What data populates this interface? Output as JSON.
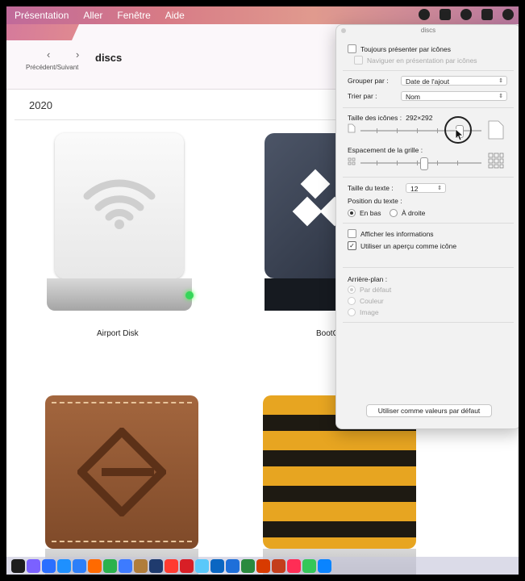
{
  "menubar": {
    "items": [
      "Présentation",
      "Aller",
      "Fenêtre",
      "Aide"
    ]
  },
  "window": {
    "nav_arrows": "‹ ›",
    "nav_label": "Précédent/Suivant",
    "title": "discs",
    "group_header": "2020",
    "items": [
      {
        "label": "Airport Disk"
      },
      {
        "label": "BootC"
      }
    ]
  },
  "panel": {
    "title": "discs",
    "always_icons": "Toujours présenter par icônes",
    "browse_icons": "Naviguer en présentation par icônes",
    "group_by_label": "Grouper par :",
    "group_by_value": "Date de l'ajout",
    "sort_by_label": "Trier par :",
    "sort_by_value": "Nom",
    "icon_size_label": "Taille des icônes :",
    "icon_size_value": "292×292",
    "grid_spacing_label": "Espacement de la grille :",
    "text_size_label": "Taille du texte :",
    "text_size_value": "12",
    "text_position_label": "Position du texte :",
    "pos_bottom": "En bas",
    "pos_right": "À droite",
    "show_info": "Afficher les informations",
    "use_preview": "Utiliser un aperçu comme icône",
    "background_label": "Arrière-plan :",
    "bg_default": "Par défaut",
    "bg_color": "Couleur",
    "bg_image": "Image",
    "use_defaults": "Utiliser comme valeurs par défaut"
  },
  "dock": {
    "colors": [
      "#1d1d1d",
      "#7b61ff",
      "#2b6fff",
      "#1e90ff",
      "#2d7ff9",
      "#ff6a00",
      "#2bb24c",
      "#3d7bff",
      "#b07d3b",
      "#1f3b6e",
      "#ff3b30",
      "#d81f26",
      "#5ac8fa",
      "#0a66c2",
      "#1e6fd9",
      "#2a8a3e",
      "#d83b01",
      "#c43e1c",
      "#ff2d55",
      "#34c759",
      "#0a84ff"
    ]
  }
}
